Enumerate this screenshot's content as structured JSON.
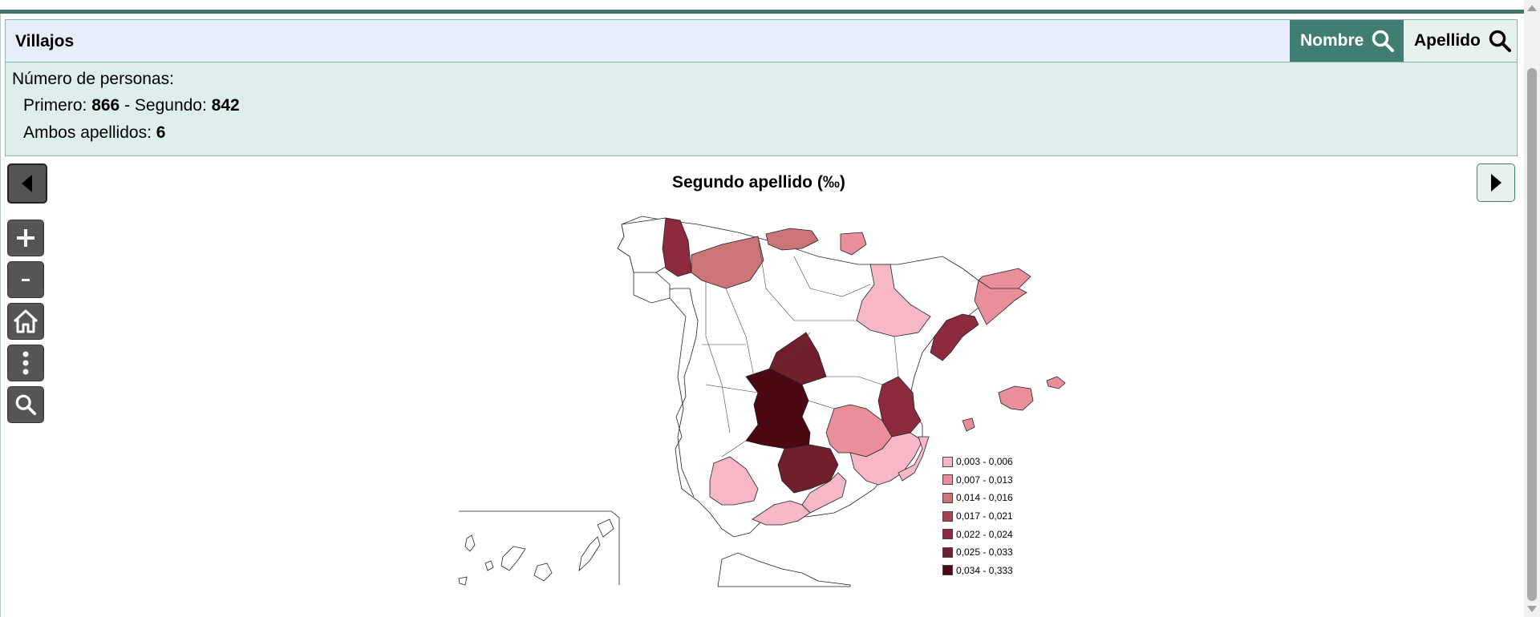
{
  "search": {
    "query": "Villajos",
    "nombre_label": "Nombre",
    "apellido_label": "Apellido"
  },
  "info": {
    "count_label": "Número de personas:",
    "primero_label": "Primero: ",
    "primero_value": "866",
    "separator": " - Segundo: ",
    "segundo_value": "842",
    "ambos_label": "Ambos apellidos: ",
    "ambos_value": "6"
  },
  "map": {
    "title": "Segundo apellido (‰)",
    "legend": [
      {
        "label": "0,003 - 0,006",
        "color": "#f5b8c4"
      },
      {
        "label": "0,007 - 0,013",
        "color": "#e98f9c"
      },
      {
        "label": "0,014 - 0,016",
        "color": "#cc7578"
      },
      {
        "label": "0,017 - 0,021",
        "color": "#a9404e"
      },
      {
        "label": "0,022 - 0,024",
        "color": "#8e2a3f"
      },
      {
        "label": "0,025 - 0,033",
        "color": "#711f2c"
      },
      {
        "label": "0,034 - 0,333",
        "color": "#4b0812"
      }
    ]
  },
  "controls": {
    "icons": [
      "chevron-left-icon",
      "plus-icon",
      "minus-icon",
      "home-icon",
      "more-vertical-icon",
      "search-icon",
      "chevron-right-icon"
    ]
  }
}
